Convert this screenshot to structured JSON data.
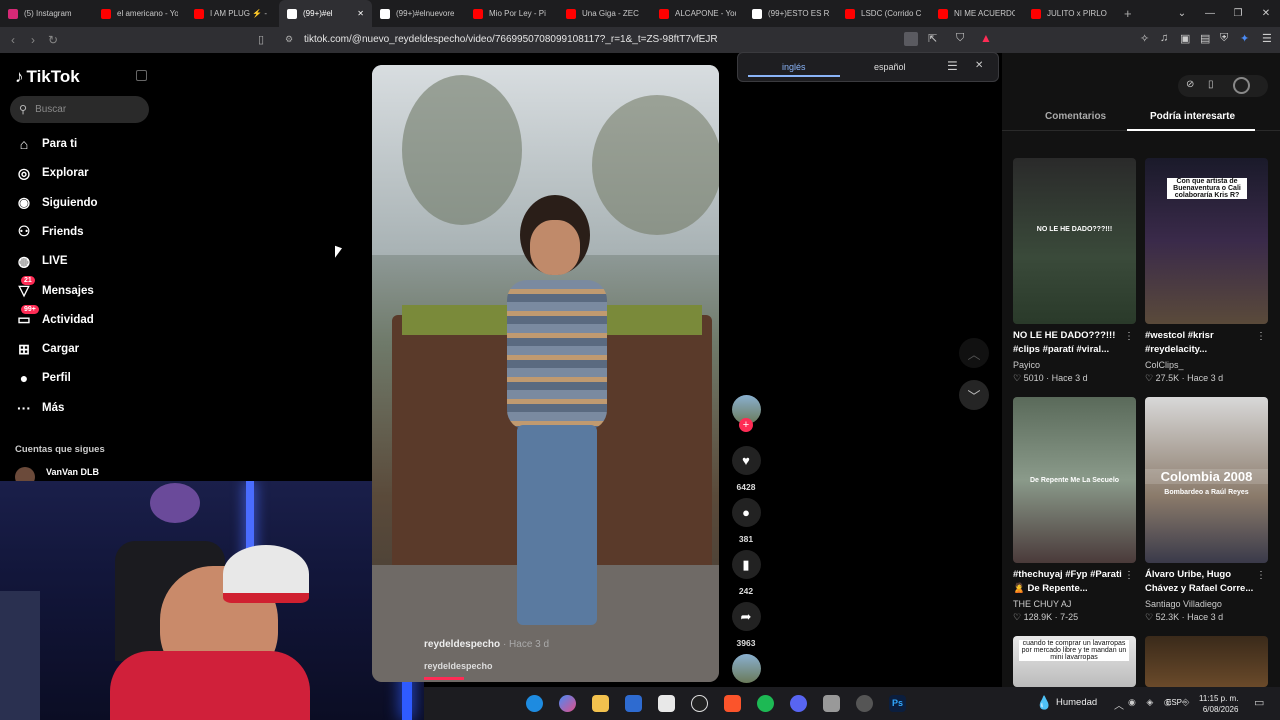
{
  "tabs": [
    {
      "title": "(5) Instagram",
      "color": "#d62976"
    },
    {
      "title": "el americano - Yo",
      "color": "#ff0000"
    },
    {
      "title": "I AM PLUG ⚡ -",
      "color": "#ff0000"
    },
    {
      "title": "(99+)#el",
      "color": "#ffffff",
      "active": true
    },
    {
      "title": "(99+)#elnuevore",
      "color": "#ffffff"
    },
    {
      "title": "Mio Por Ley - Pi",
      "color": "#ff0000"
    },
    {
      "title": "Una Giga - ZEC",
      "color": "#ff0000"
    },
    {
      "title": "ALCAPONE - You",
      "color": "#ff0000"
    },
    {
      "title": "(99+)ESTO ES R",
      "color": "#ffffff"
    },
    {
      "title": "LSDC (Corrido C",
      "color": "#ff0000"
    },
    {
      "title": "NI ME ACUERDO",
      "color": "#ff0000"
    },
    {
      "title": "JULITO x PIRLO",
      "color": "#ff0000"
    }
  ],
  "address_bar": {
    "url": "tiktok.com/@nuevo_reydeldespecho/video/7669950708099108117?_r=1&_t=ZS-98ftT7vfEJR"
  },
  "sidebar": {
    "logo": "TikTok",
    "search_placeholder": "Buscar",
    "items": [
      {
        "label": "Para ti",
        "icon": "home-icon"
      },
      {
        "label": "Explorar",
        "icon": "compass-icon"
      },
      {
        "label": "Siguiendo",
        "icon": "following-icon"
      },
      {
        "label": "Friends",
        "icon": "friends-icon"
      },
      {
        "label": "LIVE",
        "icon": "live-icon"
      },
      {
        "label": "Mensajes",
        "icon": "messages-icon",
        "badge": "21"
      },
      {
        "label": "Actividad",
        "icon": "activity-icon",
        "badge": "99+"
      },
      {
        "label": "Cargar",
        "icon": "upload-icon"
      },
      {
        "label": "Perfil",
        "icon": "profile-icon"
      },
      {
        "label": "Más",
        "icon": "more-icon"
      }
    ],
    "following_title": "Cuentas que sigues",
    "following_first": "VanVan DLB"
  },
  "video": {
    "author": "reydeldespecho",
    "time": "· Hace 3 d",
    "sound": "reydeldespecho",
    "likes": "6428",
    "comments": "381",
    "saves": "242",
    "shares": "3963"
  },
  "translate": {
    "lang_from": "inglés",
    "lang_to": "español"
  },
  "right_panel": {
    "tab_comments": "Comentarios",
    "tab_suggested": "Podría interesarte",
    "cards": [
      {
        "caption": "NO LE HE DADO???!!! #clips #paratí #viral...",
        "author": "Payico",
        "stats": "♡ 5010 · Hace 3 d",
        "overlay": "NO LE HE DADO???!!!"
      },
      {
        "caption": "#westcol #krisr #reydelacity...",
        "author": "ColClips_",
        "stats": "♡ 27.5K · Hace 3 d",
        "overlay": "Con que artista de Buenaventura o Cali colaboraría Kris R?"
      },
      {
        "caption": "#thechuyaj #Fyp #Parati 🙎 De Repente...",
        "author": "THE CHUY AJ",
        "stats": "♡ 128.9K · 7-25",
        "overlay": "De Repente Me La Secuelo"
      },
      {
        "caption": "Álvaro Uribe, Hugo Chávez y Rafael Corre...",
        "author": "Santiago Villadiego",
        "stats": "♡ 52.3K · Hace 3 d",
        "overlay": "Colombia 2008",
        "overlay2": "Bombardeo a Raúl Reyes"
      },
      {
        "caption": "",
        "author": "",
        "stats": "",
        "overlay": "cuando te comprar un lavarropas por mercado libre y te mandan un mini lavarropas"
      },
      {
        "caption": "",
        "author": "",
        "stats": "",
        "overlay": ""
      }
    ]
  },
  "taskbar": {
    "weather": "Humedad",
    "lang": "ESP",
    "time": "11:15 p. m.",
    "date": "6/08/2026"
  }
}
